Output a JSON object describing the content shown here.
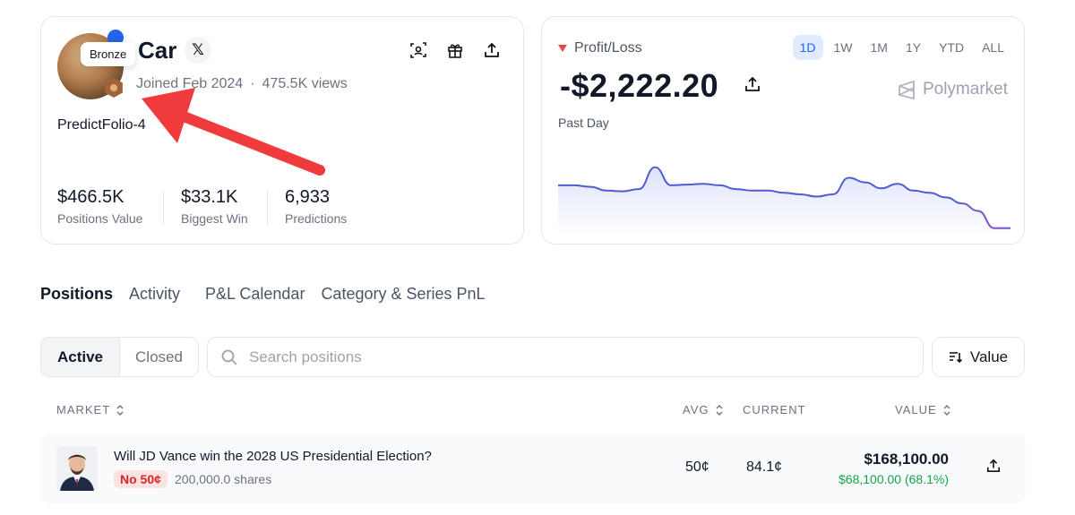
{
  "profile": {
    "name": "Car",
    "social_icon": "x-logo-icon",
    "social_label": "𝕏",
    "joined": "Joined Feb 2024",
    "separator": "·",
    "views": "475.5K views",
    "tooltip": "Bronze",
    "portfolio_name": "PredictFolio-4",
    "actions": [
      "scan-icon",
      "gift-icon",
      "share-icon"
    ],
    "stats": [
      {
        "value": "$466.5K",
        "label": "Positions Value"
      },
      {
        "value": "$33.1K",
        "label": "Biggest Win"
      },
      {
        "value": "6,933",
        "label": "Predictions"
      }
    ]
  },
  "pnl": {
    "label": "Profit/Loss",
    "value": "-$2,222.20",
    "period_label": "Past Day",
    "ranges": [
      "1D",
      "1W",
      "1M",
      "1Y",
      "YTD",
      "ALL"
    ],
    "active_range": "1D",
    "brand": "Polymarket",
    "colors": {
      "line": "#4f5bd5",
      "fill": "#e7e9fb",
      "end": "#7c4fd0",
      "loss": "#ef4444"
    }
  },
  "chart_data": {
    "type": "area",
    "values": [
      0.62,
      0.62,
      0.6,
      0.55,
      0.54,
      0.57,
      0.86,
      0.62,
      0.63,
      0.64,
      0.62,
      0.57,
      0.55,
      0.55,
      0.52,
      0.5,
      0.47,
      0.5,
      0.72,
      0.66,
      0.58,
      0.64,
      0.55,
      0.52,
      0.46,
      0.38,
      0.28,
      0.05,
      0.05
    ],
    "title": "",
    "xlabel": "",
    "ylabel": ""
  },
  "tabs": [
    "Positions",
    "Activity",
    "P&L Calendar",
    "Category & Series PnL"
  ],
  "toolbar": {
    "active_label": "Active",
    "closed_label": "Closed",
    "search_placeholder": "Search positions",
    "sort_label": "Value"
  },
  "table": {
    "headers": {
      "market": "MARKET",
      "avg": "AVG",
      "current": "CURRENT",
      "value": "VALUE"
    },
    "rows": [
      {
        "question": "Will JD Vance win the 2028 US Presidential Election?",
        "outcome": "No 50¢",
        "shares": "200,000.0 shares",
        "avg": "50¢",
        "current": "84.1¢",
        "value": "$168,100.00",
        "gain": "$68,100.00 (68.1%)"
      }
    ]
  }
}
